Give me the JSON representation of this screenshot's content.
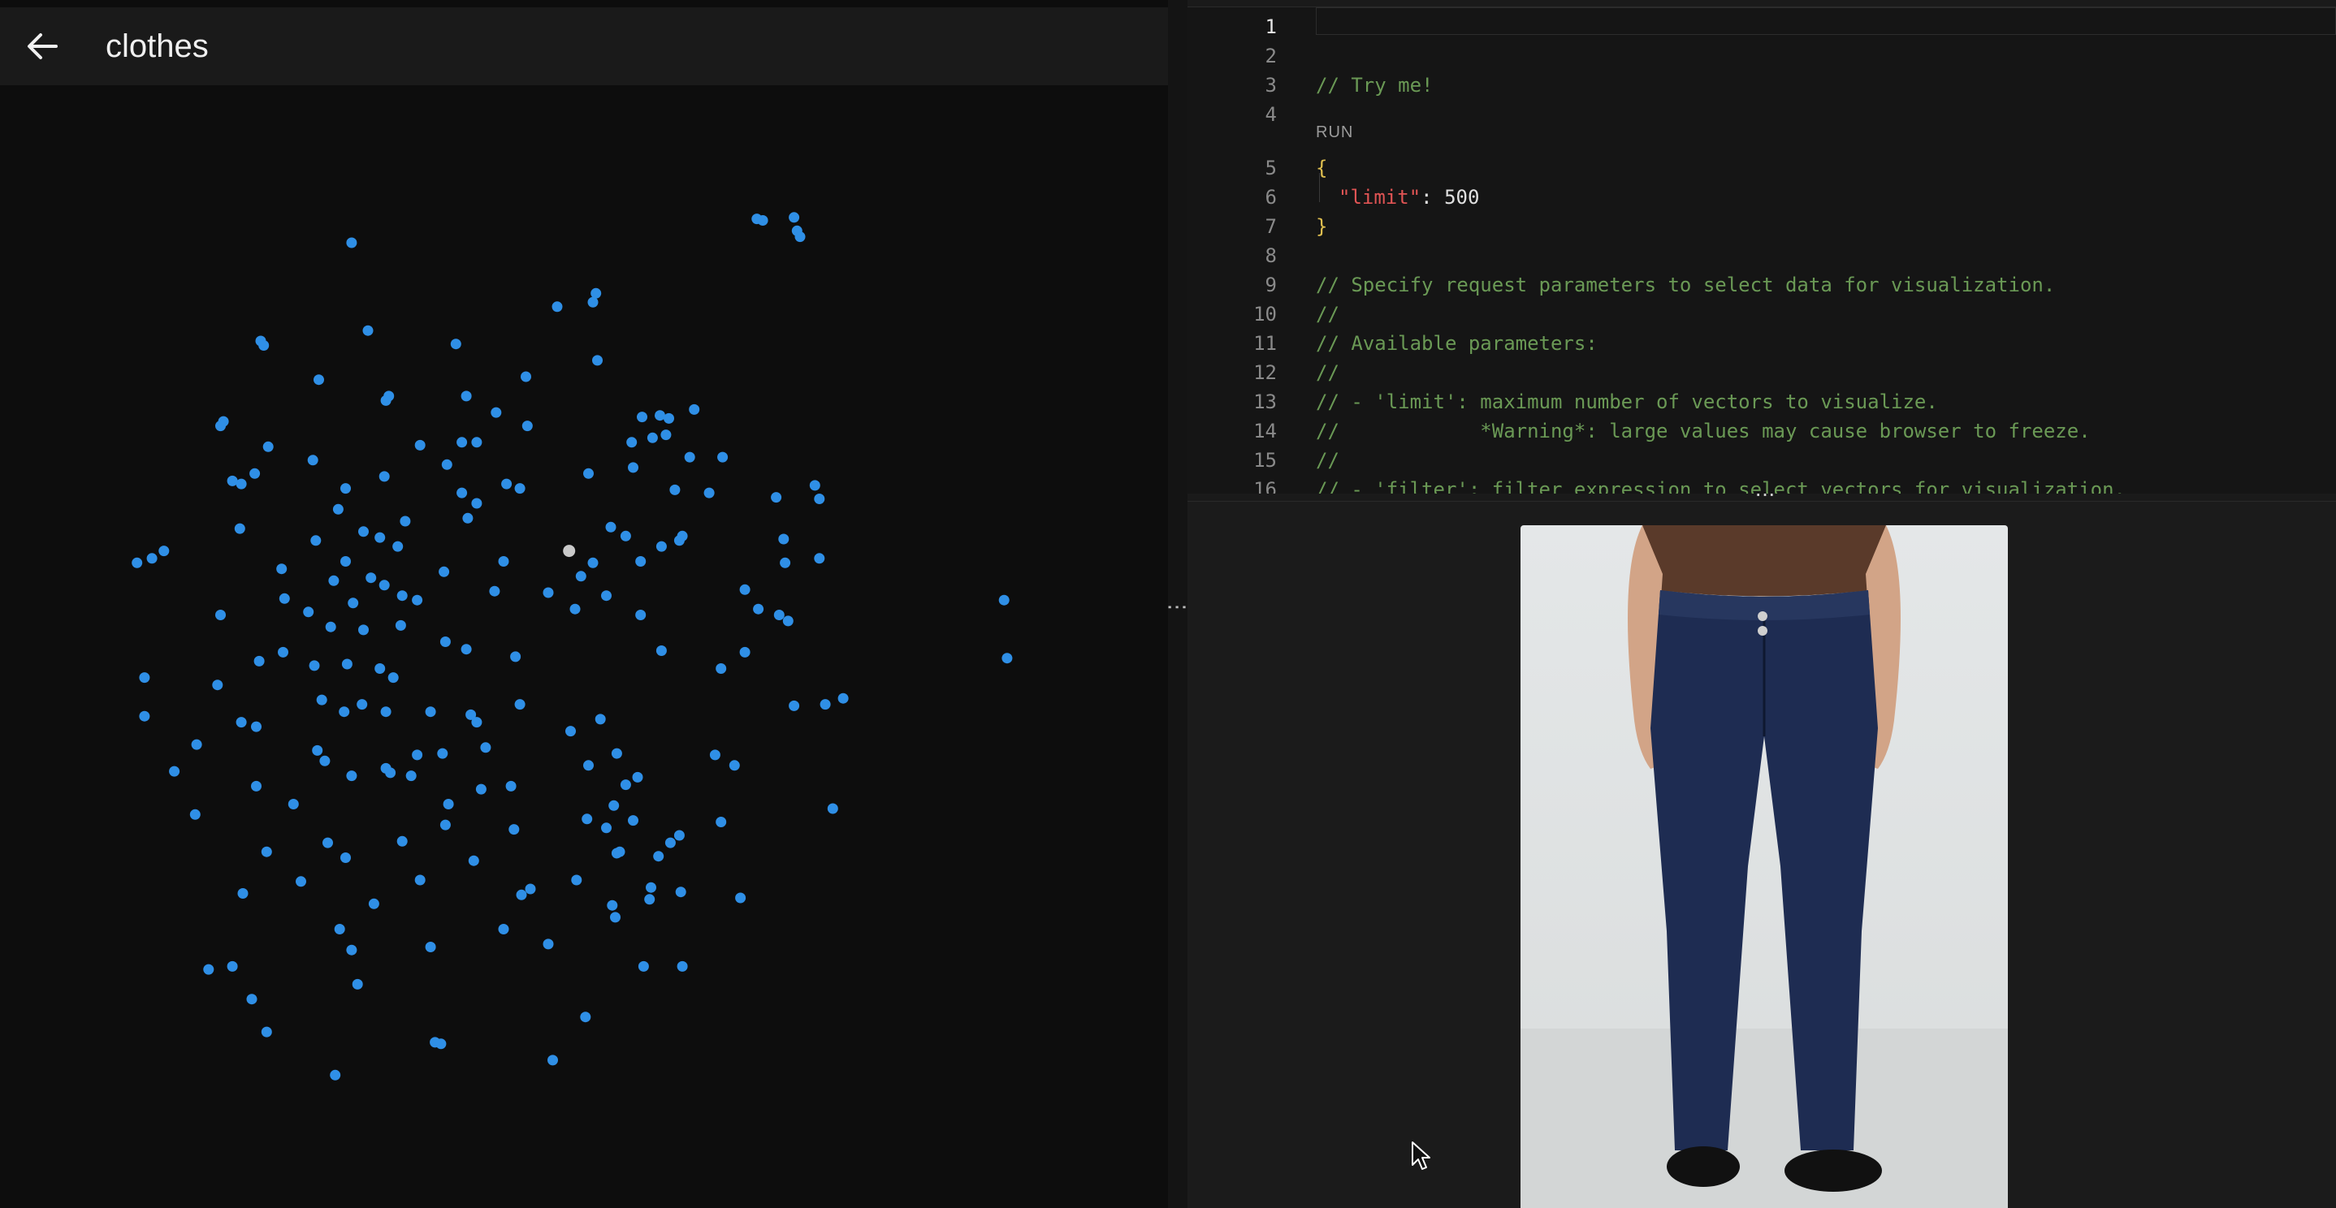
{
  "header": {
    "title": "clothes"
  },
  "colors": {
    "point": "#2f8fe6",
    "selected_point": "#c9c9c9",
    "comment": "#6a9955",
    "brace": "#e0c050",
    "key": "#e05454"
  },
  "editor": {
    "run_label": "RUN",
    "line_numbers": [
      "1",
      "2",
      "3",
      "4",
      "5",
      "6",
      "7",
      "8",
      "9",
      "10",
      "11",
      "12",
      "13",
      "14",
      "15",
      "16"
    ],
    "lines": {
      "l3": "// Try me!",
      "l5": "{",
      "l6_key": "\"limit\"",
      "l6_sep": ": ",
      "l6_val": "500",
      "l7": "}",
      "l9": "// Specify request parameters to select data for visualization.",
      "l10": "//",
      "l11": "// Available parameters:",
      "l12": "//",
      "l13": "// - 'limit': maximum number of vectors to visualize.",
      "l14": "//            *Warning*: large values may cause browser to freeze.",
      "l15": "//",
      "l16": "// - 'filter': filter expression to select vectors for visualization."
    }
  },
  "scatter": {
    "points": [
      [
        236,
        163
      ],
      [
        508,
        147
      ],
      [
        512,
        148
      ],
      [
        533,
        146
      ],
      [
        535,
        155
      ],
      [
        537,
        159
      ],
      [
        374,
        206
      ],
      [
        398,
        203
      ],
      [
        400,
        197
      ],
      [
        247,
        222
      ],
      [
        175,
        229
      ],
      [
        177,
        232
      ],
      [
        306,
        231
      ],
      [
        401,
        242
      ],
      [
        214,
        255
      ],
      [
        353,
        253
      ],
      [
        261,
        266
      ],
      [
        259,
        269
      ],
      [
        313,
        266
      ],
      [
        333,
        277
      ],
      [
        150,
        283
      ],
      [
        148,
        286
      ],
      [
        354,
        286
      ],
      [
        431,
        280
      ],
      [
        443,
        279
      ],
      [
        449,
        281
      ],
      [
        466,
        275
      ],
      [
        438,
        294
      ],
      [
        447,
        292
      ],
      [
        424,
        297
      ],
      [
        320,
        297
      ],
      [
        310,
        297
      ],
      [
        282,
        299
      ],
      [
        180,
        300
      ],
      [
        210,
        309
      ],
      [
        300,
        312
      ],
      [
        463,
        307
      ],
      [
        485,
        307
      ],
      [
        425,
        314
      ],
      [
        156,
        323
      ],
      [
        162,
        325
      ],
      [
        171,
        318
      ],
      [
        258,
        320
      ],
      [
        232,
        328
      ],
      [
        340,
        325
      ],
      [
        349,
        328
      ],
      [
        395,
        318
      ],
      [
        453,
        329
      ],
      [
        476,
        331
      ],
      [
        521,
        334
      ],
      [
        547,
        326
      ],
      [
        550,
        335
      ],
      [
        227,
        342
      ],
      [
        310,
        331
      ],
      [
        320,
        338
      ],
      [
        161,
        355
      ],
      [
        272,
        350
      ],
      [
        314,
        348
      ],
      [
        244,
        357
      ],
      [
        255,
        361
      ],
      [
        267,
        367
      ],
      [
        212,
        363
      ],
      [
        410,
        354
      ],
      [
        420,
        360
      ],
      [
        444,
        367
      ],
      [
        456,
        363
      ],
      [
        458,
        360
      ],
      [
        526,
        362
      ],
      [
        110,
        370
      ],
      [
        92,
        378
      ],
      [
        102,
        375
      ],
      [
        232,
        377
      ],
      [
        189,
        382
      ],
      [
        224,
        390
      ],
      [
        249,
        388
      ],
      [
        298,
        384
      ],
      [
        338,
        377
      ],
      [
        398,
        378
      ],
      [
        430,
        377
      ],
      [
        527,
        378
      ],
      [
        550,
        375
      ],
      [
        258,
        393
      ],
      [
        191,
        402
      ],
      [
        237,
        405
      ],
      [
        270,
        400
      ],
      [
        280,
        403
      ],
      [
        332,
        397
      ],
      [
        368,
        398
      ],
      [
        390,
        387
      ],
      [
        407,
        400
      ],
      [
        500,
        396
      ],
      [
        207,
        411
      ],
      [
        148,
        413
      ],
      [
        386,
        409
      ],
      [
        430,
        413
      ],
      [
        509,
        409
      ],
      [
        523,
        413
      ],
      [
        529,
        417
      ],
      [
        222,
        421
      ],
      [
        244,
        423
      ],
      [
        269,
        420
      ],
      [
        299,
        431
      ],
      [
        313,
        436
      ],
      [
        346,
        441
      ],
      [
        444,
        437
      ],
      [
        500,
        438
      ],
      [
        174,
        444
      ],
      [
        190,
        438
      ],
      [
        233,
        446
      ],
      [
        211,
        447
      ],
      [
        255,
        449
      ],
      [
        264,
        455
      ],
      [
        97,
        455
      ],
      [
        146,
        460
      ],
      [
        216,
        470
      ],
      [
        243,
        473
      ],
      [
        349,
        473
      ],
      [
        484,
        449
      ],
      [
        533,
        474
      ],
      [
        554,
        473
      ],
      [
        566,
        469
      ],
      [
        97,
        481
      ],
      [
        162,
        485
      ],
      [
        172,
        488
      ],
      [
        231,
        478
      ],
      [
        259,
        478
      ],
      [
        289,
        478
      ],
      [
        316,
        480
      ],
      [
        320,
        485
      ],
      [
        403,
        483
      ],
      [
        383,
        491
      ],
      [
        132,
        500
      ],
      [
        117,
        518
      ],
      [
        213,
        504
      ],
      [
        218,
        511
      ],
      [
        259,
        516
      ],
      [
        262,
        519
      ],
      [
        280,
        507
      ],
      [
        297,
        506
      ],
      [
        326,
        502
      ],
      [
        414,
        506
      ],
      [
        480,
        507
      ],
      [
        493,
        514
      ],
      [
        172,
        528
      ],
      [
        236,
        521
      ],
      [
        276,
        521
      ],
      [
        323,
        530
      ],
      [
        343,
        528
      ],
      [
        395,
        514
      ],
      [
        420,
        527
      ],
      [
        428,
        522
      ],
      [
        412,
        541
      ],
      [
        394,
        550
      ],
      [
        407,
        556
      ],
      [
        197,
        540
      ],
      [
        131,
        547
      ],
      [
        301,
        540
      ],
      [
        299,
        554
      ],
      [
        345,
        557
      ],
      [
        425,
        551
      ],
      [
        484,
        552
      ],
      [
        559,
        543
      ],
      [
        220,
        566
      ],
      [
        232,
        576
      ],
      [
        270,
        565
      ],
      [
        179,
        572
      ],
      [
        318,
        578
      ],
      [
        416,
        572
      ],
      [
        414,
        573
      ],
      [
        450,
        566
      ],
      [
        456,
        561
      ],
      [
        442,
        575
      ],
      [
        163,
        600
      ],
      [
        202,
        592
      ],
      [
        282,
        591
      ],
      [
        251,
        607
      ],
      [
        350,
        601
      ],
      [
        356,
        597
      ],
      [
        387,
        591
      ],
      [
        411,
        608
      ],
      [
        413,
        616
      ],
      [
        437,
        596
      ],
      [
        436,
        604
      ],
      [
        457,
        599
      ],
      [
        497,
        603
      ],
      [
        228,
        624
      ],
      [
        338,
        624
      ],
      [
        368,
        634
      ],
      [
        236,
        638
      ],
      [
        289,
        636
      ],
      [
        140,
        651
      ],
      [
        156,
        649
      ],
      [
        240,
        661
      ],
      [
        432,
        649
      ],
      [
        458,
        649
      ],
      [
        169,
        671
      ],
      [
        393,
        683
      ],
      [
        179,
        693
      ],
      [
        292,
        700
      ],
      [
        296,
        701
      ],
      [
        371,
        712
      ],
      [
        225,
        722
      ],
      [
        674,
        403
      ],
      [
        676,
        442
      ]
    ],
    "selected": [
      382,
      370
    ]
  }
}
